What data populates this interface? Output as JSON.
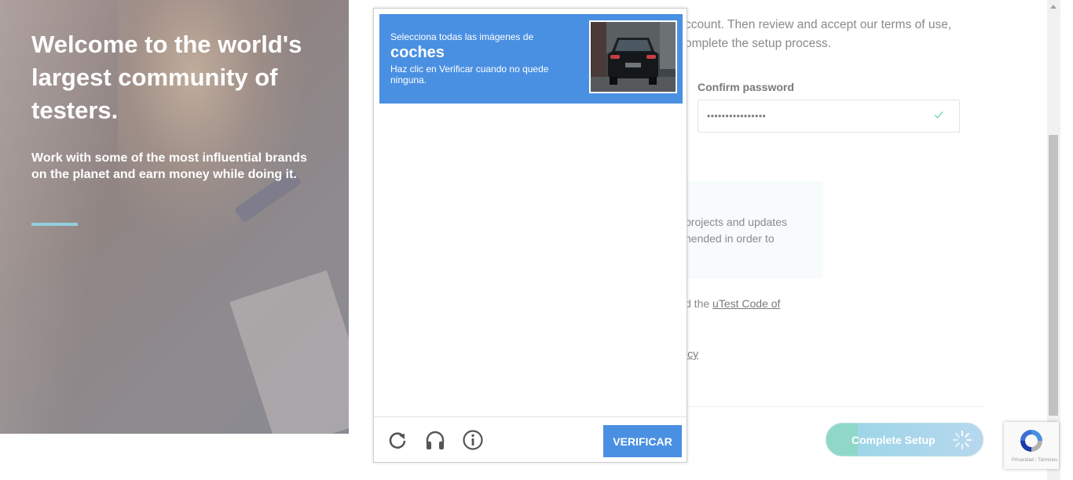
{
  "hero": {
    "title": "Welcome to the world's largest community of testers.",
    "subtitle": "Work with some of the most influential brands on the planet and earn money while doing it."
  },
  "form": {
    "intro_line1": "ccount. Then review and accept our terms of use,",
    "intro_line2": "omplete the setup process.",
    "confirm_password_label": "Confirm password",
    "confirm_password_value": "••••••••••••••••",
    "notice_line1": "projects and updates",
    "notice_line2": "nended in order to",
    "code_prefix": "d the ",
    "code_link": "uTest Code of",
    "policy_fragment": "icy",
    "complete_setup_label": "Complete Setup"
  },
  "captcha": {
    "prompt_small": "Selecciona todas las imágenes de",
    "prompt_big": "coches",
    "instruction": "Haz clic en Verificar cuando no quede ninguna.",
    "verify_label": "VERIFICAR",
    "icons": [
      "reload-icon",
      "audio-icon",
      "info-icon"
    ]
  },
  "badge": {
    "terms": "Privacidad - Términos"
  },
  "colors": {
    "accent_blue": "#4a90e2",
    "hero_line": "#8fd0dc",
    "check_green": "#7fd6b5"
  }
}
